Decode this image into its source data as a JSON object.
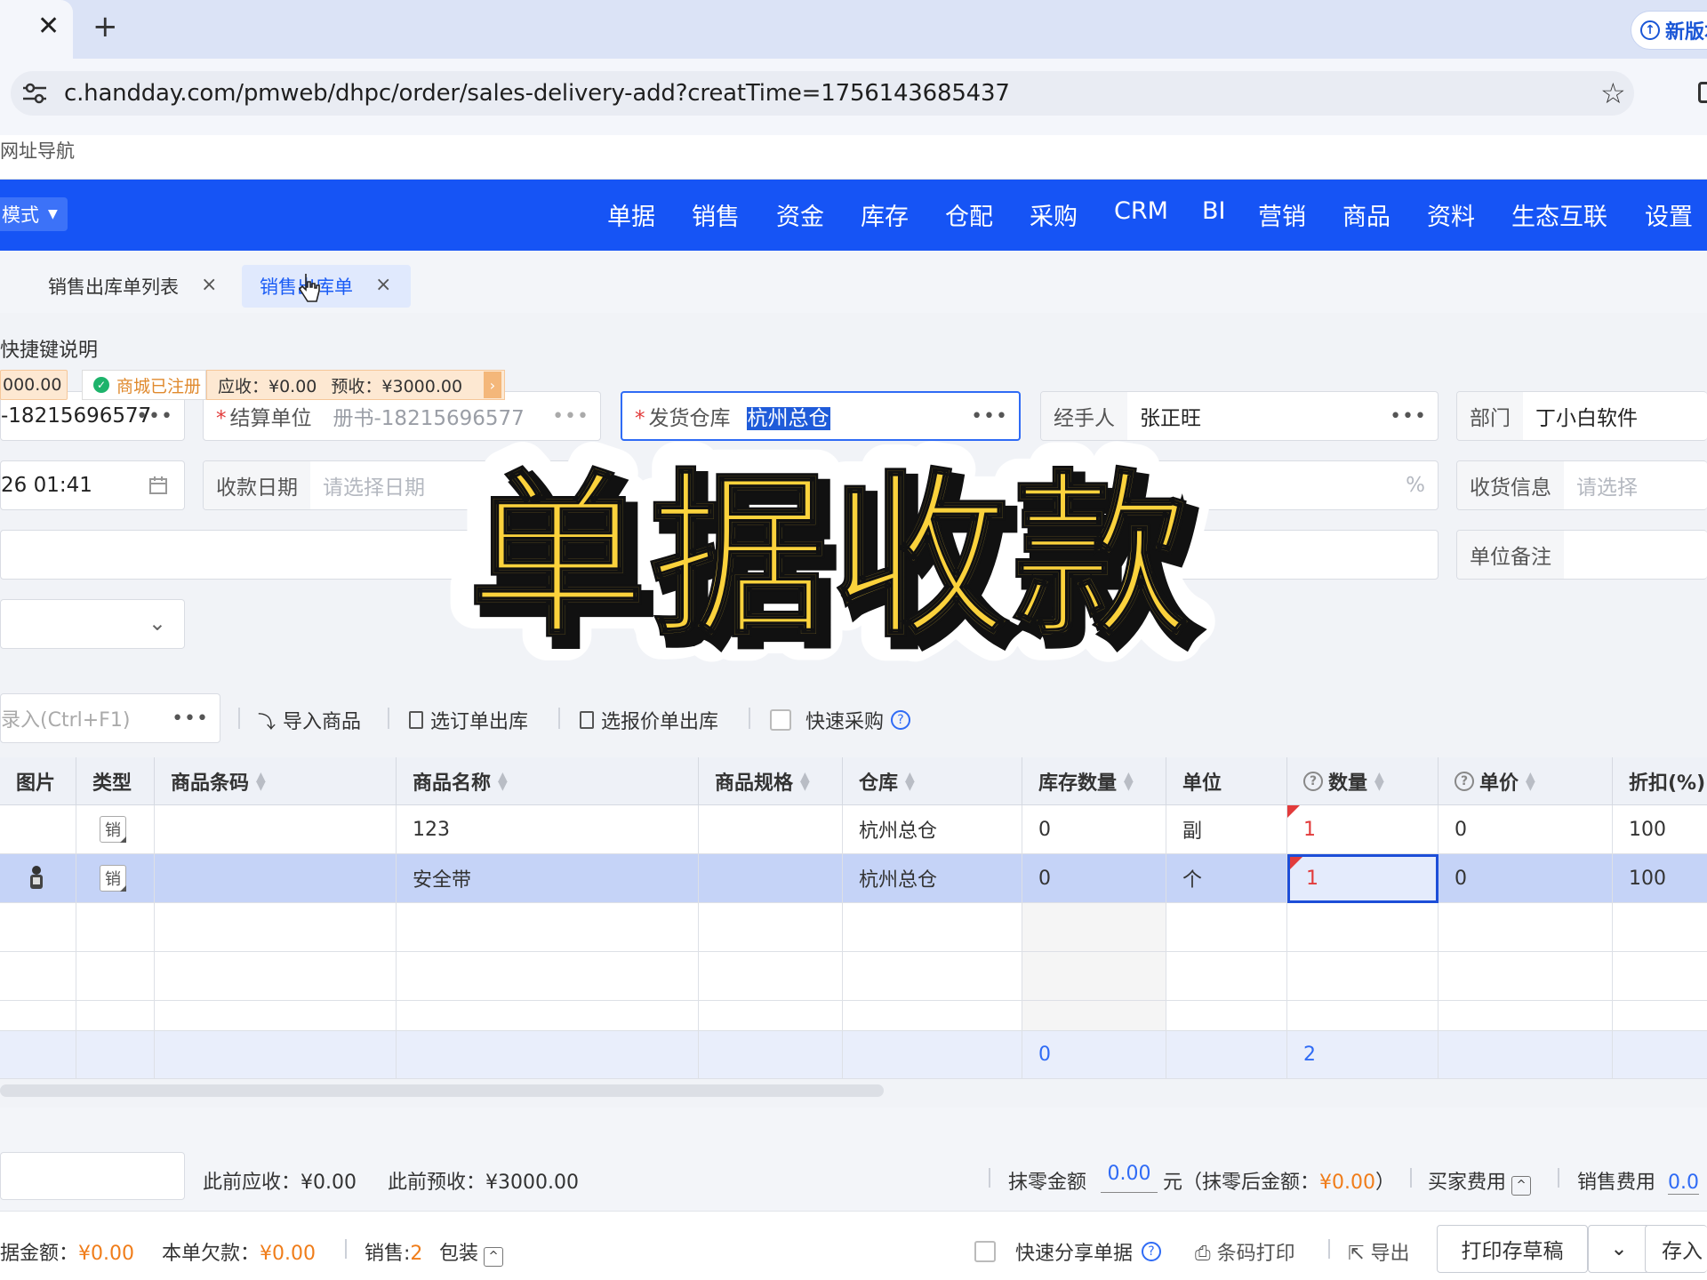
{
  "browser": {
    "url": "c.handday.com/pmweb/dhpc/order/sales-delivery-add?creatTime=1756143685437",
    "tab_close": "✕",
    "new_tab": "+",
    "update_button": "新版本",
    "bookmark": "网址导航"
  },
  "nav": {
    "mode": "模式",
    "items": [
      "单据",
      "销售",
      "资金",
      "库存",
      "仓配",
      "采购",
      "CRM",
      "BI",
      "营销",
      "商品",
      "资料",
      "生态互联",
      "设置"
    ]
  },
  "page_tabs": {
    "list_tab": "销售出库单列表",
    "current_tab": "销售出库单"
  },
  "shortcut_hint": "快捷键说明",
  "badges": {
    "left_amount": "000.00",
    "mall": "商城已注册",
    "receivable": "应收：¥0.00",
    "prepaid": "预收：¥3000.00"
  },
  "form": {
    "customer_value": "-18215696577",
    "settle_label": "结算单位",
    "settle_value": "册书-18215696577",
    "warehouse_label": "发货仓库",
    "warehouse_value": "杭州总仓",
    "handler_label": "经手人",
    "handler_value": "张正旺",
    "dept_label": "部门",
    "dept_value": "丁小白软件",
    "date_value": "26 01:41",
    "collect_label": "收款日期",
    "collect_placeholder": "请选择日期",
    "percent": "%",
    "receive_label": "收货信息",
    "receive_placeholder": "请选择",
    "unit_remark_label": "单位备注"
  },
  "toolbar": {
    "entry_placeholder": "录入(Ctrl+F1)",
    "import": "导入商品",
    "select_order": "选订单出库",
    "select_quote": "选报价单出库",
    "quick_purchase": "快速采购"
  },
  "table": {
    "headers": [
      "图片",
      "类型",
      "商品条码",
      "商品名称",
      "商品规格",
      "仓库",
      "库存数量",
      "单位",
      "数量",
      "单价",
      "折扣(%)"
    ],
    "rows": [
      {
        "type": "销",
        "barcode": "",
        "name": "123",
        "spec": "",
        "warehouse": "杭州总仓",
        "stock": "0",
        "unit": "副",
        "qty": "1",
        "price": "0",
        "discount": "100"
      },
      {
        "type": "销",
        "barcode": "",
        "name": "安全带",
        "spec": "",
        "warehouse": "杭州总仓",
        "stock": "0",
        "unit": "个",
        "qty": "1",
        "price": "0",
        "discount": "100"
      }
    ],
    "totals": {
      "stock": "0",
      "qty": "2"
    }
  },
  "summary": {
    "prev_receivable_label": "此前应收：",
    "prev_receivable": "¥0.00",
    "prev_prepaid_label": "此前预收：",
    "prev_prepaid": "¥3000.00",
    "zero_label": "抹零金额",
    "zero_value": "0.00",
    "zero_unit": "元（抹零后金额：",
    "zero_after": "¥0.00",
    "zero_close": "）",
    "buyer_fee": "买家费用",
    "sales_fee": "销售费用",
    "sales_fee_value": "0.0"
  },
  "footer": {
    "doc_amount_label": "据金额：",
    "doc_amount": "¥0.00",
    "owe_label": "本单欠款：",
    "owe": "¥0.00",
    "sales_label": "销售:",
    "sales_count": "2",
    "pack": "包装",
    "quick_share": "快速分享单据",
    "barcode_print": "条码打印",
    "export": "导出",
    "print_draft": "打印存草稿",
    "save": "存入"
  },
  "overlay_title": "单据收款",
  "colors": {
    "nav": "#1654f5",
    "accent": "#2f6bf5",
    "overlay": "#fbd23c",
    "orange": "#f07d1a"
  }
}
